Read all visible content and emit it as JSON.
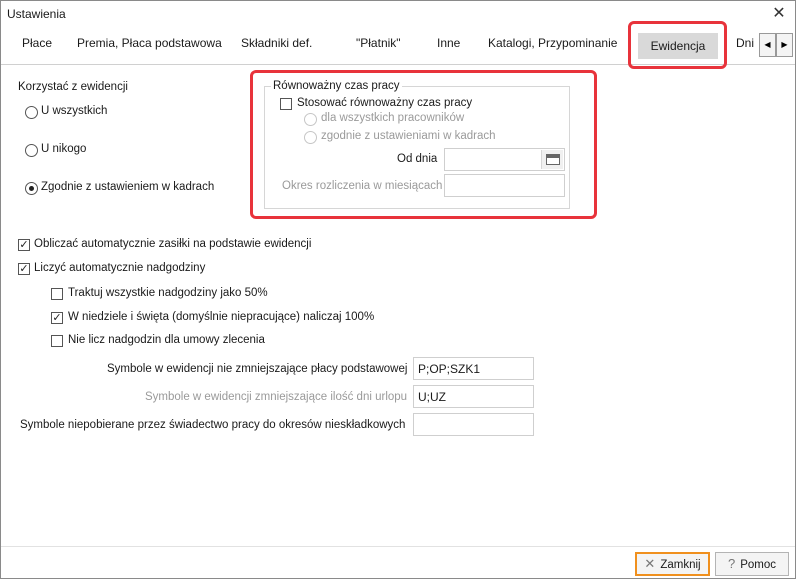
{
  "window": {
    "title": "Ustawienia",
    "close_glyph": "✕"
  },
  "tabs": {
    "items": [
      "Płace",
      "Premia, Płaca podstawowa",
      "Składniki def.",
      "\"Płatnik\"",
      "Inne",
      "Katalogi, Przypominanie",
      "Ewidencja",
      "Dni"
    ],
    "active": "Ewidencja",
    "scroll_left_glyph": "◀",
    "scroll_right_glyph": "▶"
  },
  "usage": {
    "label": "Korzystać z ewidencji",
    "options": [
      "U wszystkich",
      "U nikogo",
      "Zgodnie z ustawieniem w kadrach"
    ],
    "selected": "Zgodnie z ustawieniem w kadrach"
  },
  "equivalent": {
    "title": "Równoważny czas pracy",
    "apply_label": "Stosować równoważny czas pracy",
    "apply_checked": false,
    "option_all": "dla wszystkich pracowników",
    "option_hr": "zgodnie z ustawieniami w kadrach",
    "from_label": "Od dnia",
    "from_value": "",
    "period_label": "Okres rozliczenia w miesiącach",
    "period_value": ""
  },
  "options": {
    "calc_benefits": {
      "label": "Obliczać automatycznie zasiłki na podstawie ewidencji",
      "checked": true
    },
    "calc_overtime": {
      "label": "Liczyć automatycznie nadgodziny",
      "checked": true
    },
    "overtime_50": {
      "label": "Traktuj wszystkie nadgodziny jako 50%",
      "checked": false
    },
    "sundays_100": {
      "label": "W niedziele i święta (domyślnie niepracujące) naliczaj 100%",
      "checked": true
    },
    "no_contract": {
      "label": "Nie licz nadgodzin dla umowy zlecenia",
      "checked": false
    }
  },
  "symbols": {
    "not_reducing": {
      "label": "Symbole w ewidencji nie zmniejszające płacy podstawowej",
      "value": "P;OP;SZK1"
    },
    "reducing_leave": {
      "label": "Symbole w ewidencji zmniejszające ilość dni urlopu",
      "value": "U;UZ"
    },
    "not_collected": {
      "label": "Symbole niepobierane przez świadectwo pracy do okresów nieskładkowych",
      "value": ""
    }
  },
  "footer": {
    "close_label": "Zamknij",
    "close_icon": "✕",
    "help_label": "Pomoc",
    "help_icon": "?"
  }
}
